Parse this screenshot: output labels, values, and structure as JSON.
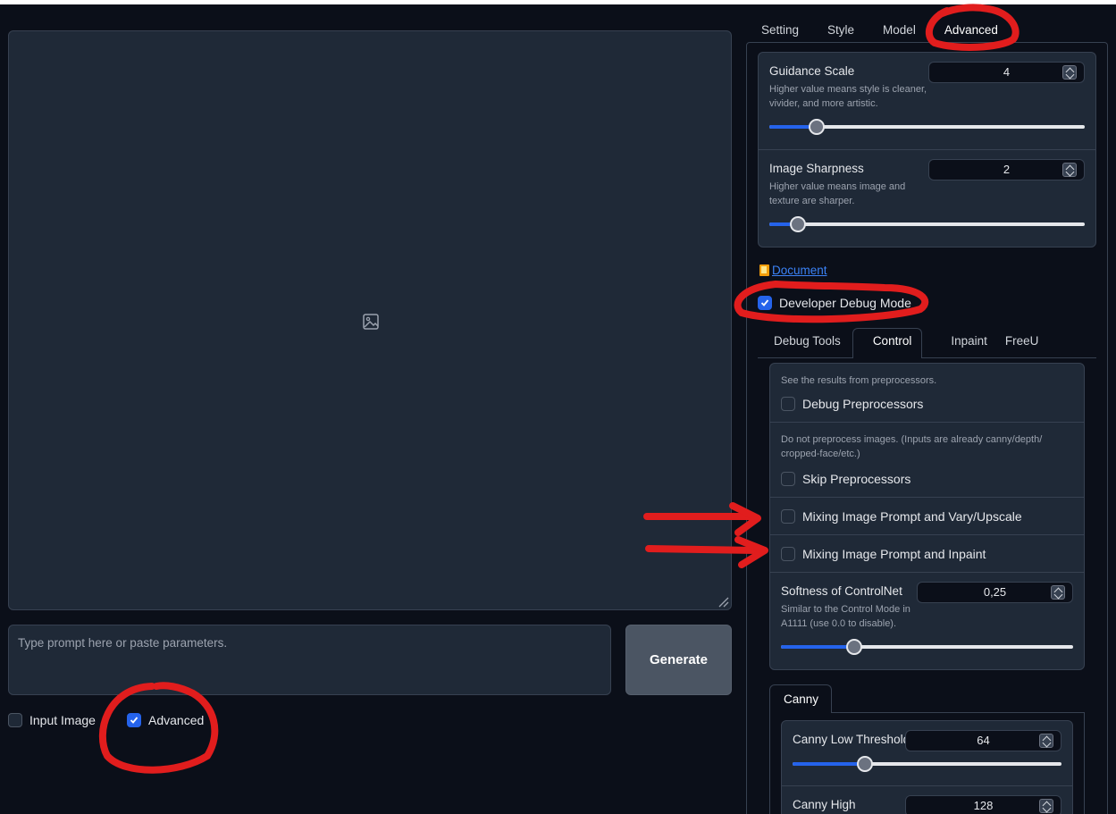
{
  "main_tabs": [
    "Setting",
    "Style",
    "Model",
    "Advanced"
  ],
  "advanced": {
    "guidance_scale": {
      "title": "Guidance Scale",
      "info": "Higher value means style is cleaner, vivider, and more artistic.",
      "value": "4",
      "level": 0.15
    },
    "image_sharpness": {
      "title": "Image Sharpness",
      "info": "Higher value means image and texture are sharper.",
      "value": "2",
      "level": 0.09
    },
    "document_label": "Document",
    "developer_debug_mode": {
      "label": "Developer Debug Mode",
      "checked": true
    }
  },
  "debug_tabs": [
    "Debug Tools",
    "Control",
    "Inpaint",
    "FreeU"
  ],
  "control": {
    "debug_preprocessors": {
      "info": "See the results from preprocessors.",
      "label": "Debug Preprocessors",
      "checked": false
    },
    "skip_preprocessors": {
      "info": "Do not preprocess images. (Inputs are already canny/depth/ cropped-face/etc.)",
      "label": "Skip Preprocessors",
      "checked": false
    },
    "mixing_vary": {
      "label": "Mixing Image Prompt and Vary/Upscale",
      "checked": false
    },
    "mixing_inpaint": {
      "label": "Mixing Image Prompt and Inpaint",
      "checked": false
    },
    "softness": {
      "title": "Softness of ControlNet",
      "info": "Similar to the Control Mode in A1111 (use 0.0 to disable).",
      "value": "0,25",
      "level": 0.25
    }
  },
  "canny": {
    "tab": "Canny",
    "low": {
      "title": "Canny Low Threshold",
      "value": "64",
      "level": 0.27
    },
    "high": {
      "title": "Canny High",
      "value": "128"
    }
  },
  "prompt": {
    "placeholder": "Type prompt here or paste parameters."
  },
  "generate_label": "Generate",
  "bottom": {
    "input_image": {
      "label": "Input Image",
      "checked": false
    },
    "advanced": {
      "label": "Advanced",
      "checked": true
    }
  },
  "colors": {
    "accent": "#2563eb",
    "annotation": "#e11d1d",
    "background": "#0b0f19",
    "surface": "#1f2937"
  }
}
